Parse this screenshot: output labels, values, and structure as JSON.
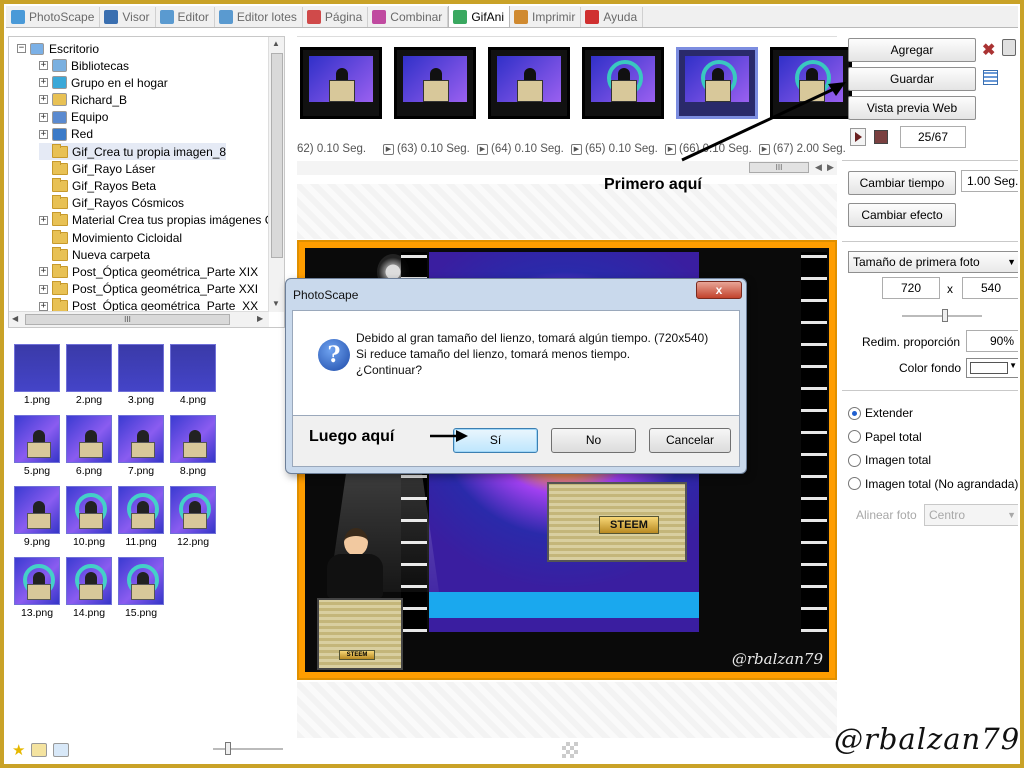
{
  "tabs": [
    {
      "label": "PhotoScape",
      "color": "#4a9ad8"
    },
    {
      "label": "Visor",
      "color": "#3a6fb0"
    },
    {
      "label": "Editor",
      "color": "#5a9ad0"
    },
    {
      "label": "Editor lotes",
      "color": "#5a9ad0"
    },
    {
      "label": "Página",
      "color": "#d04a4a"
    },
    {
      "label": "Combinar",
      "color": "#c04aa0"
    },
    {
      "label": "GifAni",
      "color": "#3aa860",
      "active": true
    },
    {
      "label": "Imprimir",
      "color": "#d08a30"
    },
    {
      "label": "Ayuda",
      "color": "#d03030"
    }
  ],
  "tree": {
    "root": "Escritorio",
    "items": [
      {
        "label": "Bibliotecas",
        "icon": "libraries-icon"
      },
      {
        "label": "Grupo en el hogar",
        "icon": "homegroup-icon"
      },
      {
        "label": "Richard_B",
        "icon": "user-folder-icon"
      },
      {
        "label": "Equipo",
        "icon": "computer-icon"
      },
      {
        "label": "Red",
        "icon": "network-icon"
      },
      {
        "label": "Gif_Crea tu propia imagen_8",
        "icon": "folder-icon",
        "selected": true
      },
      {
        "label": "Gif_Rayo Láser",
        "icon": "folder-icon"
      },
      {
        "label": "Gif_Rayos Beta",
        "icon": "folder-icon"
      },
      {
        "label": "Gif_Rayos Cósmicos",
        "icon": "folder-icon"
      },
      {
        "label": "Material Crea tus propias imágenes G",
        "icon": "folder-icon"
      },
      {
        "label": "Movimiento Cicloidal",
        "icon": "folder-icon"
      },
      {
        "label": "Nueva carpeta",
        "icon": "folder-icon"
      },
      {
        "label": "Post_Óptica geométrica_Parte XIX",
        "icon": "folder-icon"
      },
      {
        "label": "Post_Óptica geométrica_Parte XXI",
        "icon": "folder-icon"
      },
      {
        "label": "Post_Óptica geométrica_Parte_XX",
        "icon": "folder-icon"
      }
    ]
  },
  "thumbnails": [
    "1.png",
    "2.png",
    "3.png",
    "4.png",
    "5.png",
    "6.png",
    "7.png",
    "8.png",
    "9.png",
    "10.png",
    "11.png",
    "12.png",
    "13.png",
    "14.png",
    "15.png"
  ],
  "filmstrip": {
    "captions": [
      "62) 0.10 Seg.",
      "(63) 0.10 Seg.",
      "(64) 0.10 Seg.",
      "(65) 0.10 Seg.",
      "(66) 0.10 Seg.",
      "(67) 2.00 Seg."
    ]
  },
  "canvas": {
    "podium_text": "STEEM",
    "desk_text": "STEEM",
    "watermark": "@rbalzan79"
  },
  "right_panel": {
    "agregar": "Agregar",
    "guardar": "Guardar",
    "vista_previa": "Vista previa Web",
    "frame_counter": "25/67",
    "cambiar_tiempo": "Cambiar tiempo",
    "tiempo_value": "1.00 Seg.",
    "cambiar_efecto": "Cambiar efecto",
    "size_select": "Tamaño de primera foto",
    "width": "720",
    "x_label": "x",
    "height": "540",
    "redim_label": "Redim. proporción",
    "redim_value": "90%",
    "color_label": "Color fondo",
    "options": [
      "Extender",
      "Papel total",
      "Imagen total",
      "Imagen total (No agrandada)"
    ],
    "selected_option": 0,
    "align_label": "Alinear foto",
    "align_value": "Centro"
  },
  "dialog": {
    "title": "PhotoScape",
    "close": "x",
    "line1": "Debido al gran tamaño del lienzo, tomará algún tiempo. (720x540)",
    "line2": "Si reduce tamaño del lienzo, tomará menos tiempo.",
    "line3": "¿Continuar?",
    "btn_yes": "Sí",
    "btn_no": "No",
    "btn_cancel": "Cancelar"
  },
  "annotations": {
    "first": "Primero aquí",
    "then": "Luego aquí",
    "signature": "@rbalzan79"
  }
}
